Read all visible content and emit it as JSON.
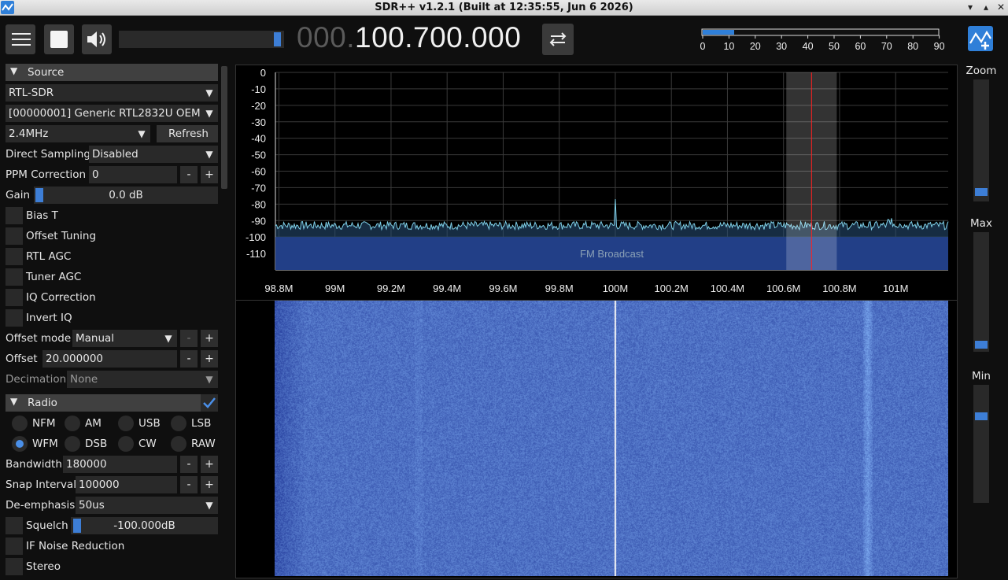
{
  "window": {
    "title": "SDR++ v1.2.1 (Built at 12:35:55, Jun  6 2026)"
  },
  "toolbar": {
    "freq_prefix": "000.",
    "freq_main": "100.700.000",
    "volume_level": 0.98,
    "snr_scale": [
      "0",
      "10",
      "20",
      "30",
      "40",
      "50",
      "60",
      "70",
      "80",
      "90"
    ],
    "snr_level": 12
  },
  "source": {
    "header": "Source",
    "device_type": "RTL-SDR",
    "device": "[00000001] Generic RTL2832U OEM",
    "sample_rate": "2.4MHz",
    "refresh_label": "Refresh",
    "direct_sampling_label": "Direct Sampling",
    "direct_sampling_value": "Disabled",
    "ppm_label": "PPM Correction",
    "ppm_value": "0",
    "gain_label": "Gain",
    "gain_value": "0.0 dB",
    "bias_t": "Bias T",
    "offset_tuning": "Offset Tuning",
    "rtl_agc": "RTL AGC",
    "tuner_agc": "Tuner AGC",
    "iq_correction": "IQ Correction",
    "invert_iq": "Invert IQ",
    "offset_mode_label": "Offset mode",
    "offset_mode_value": "Manual",
    "offset_label": "Offset",
    "offset_value": "20.000000",
    "decimation_label": "Decimation",
    "decimation_value": "None"
  },
  "radio": {
    "header": "Radio",
    "modes": [
      "NFM",
      "AM",
      "USB",
      "LSB",
      "WFM",
      "DSB",
      "CW",
      "RAW"
    ],
    "selected_mode": "WFM",
    "bandwidth_label": "Bandwidth",
    "bandwidth_value": "180000",
    "snap_label": "Snap Interval",
    "snap_value": "100000",
    "deemph_label": "De-emphasis",
    "deemph_value": "50us",
    "squelch_label": "Squelch",
    "squelch_value": "-100.000dB",
    "if_nr": "IF Noise Reduction",
    "stereo": "Stereo"
  },
  "fft": {
    "y_ticks": [
      "0",
      "-10",
      "-20",
      "-30",
      "-40",
      "-50",
      "-60",
      "-70",
      "-80",
      "-90",
      "-100",
      "-110"
    ],
    "x_ticks": [
      "98.8M",
      "99M",
      "99.2M",
      "99.4M",
      "99.6M",
      "99.8M",
      "100M",
      "100.2M",
      "100.4M",
      "100.6M",
      "100.8M",
      "101M"
    ],
    "band_label": "FM Broadcast",
    "noise_floor_db": -93,
    "peak_freq_mhz": 100.0,
    "peak_db": -77,
    "tuned_freq_mhz": 100.7,
    "vfo_bandwidth_hz": 180000
  },
  "right": {
    "zoom_label": "Zoom",
    "max_label": "Max",
    "min_label": "Min"
  },
  "colors": {
    "accent": "#3d7ed6",
    "band": "#1c2c99",
    "trace": "#7fd0e8",
    "vfo_line": "#ff2020"
  }
}
